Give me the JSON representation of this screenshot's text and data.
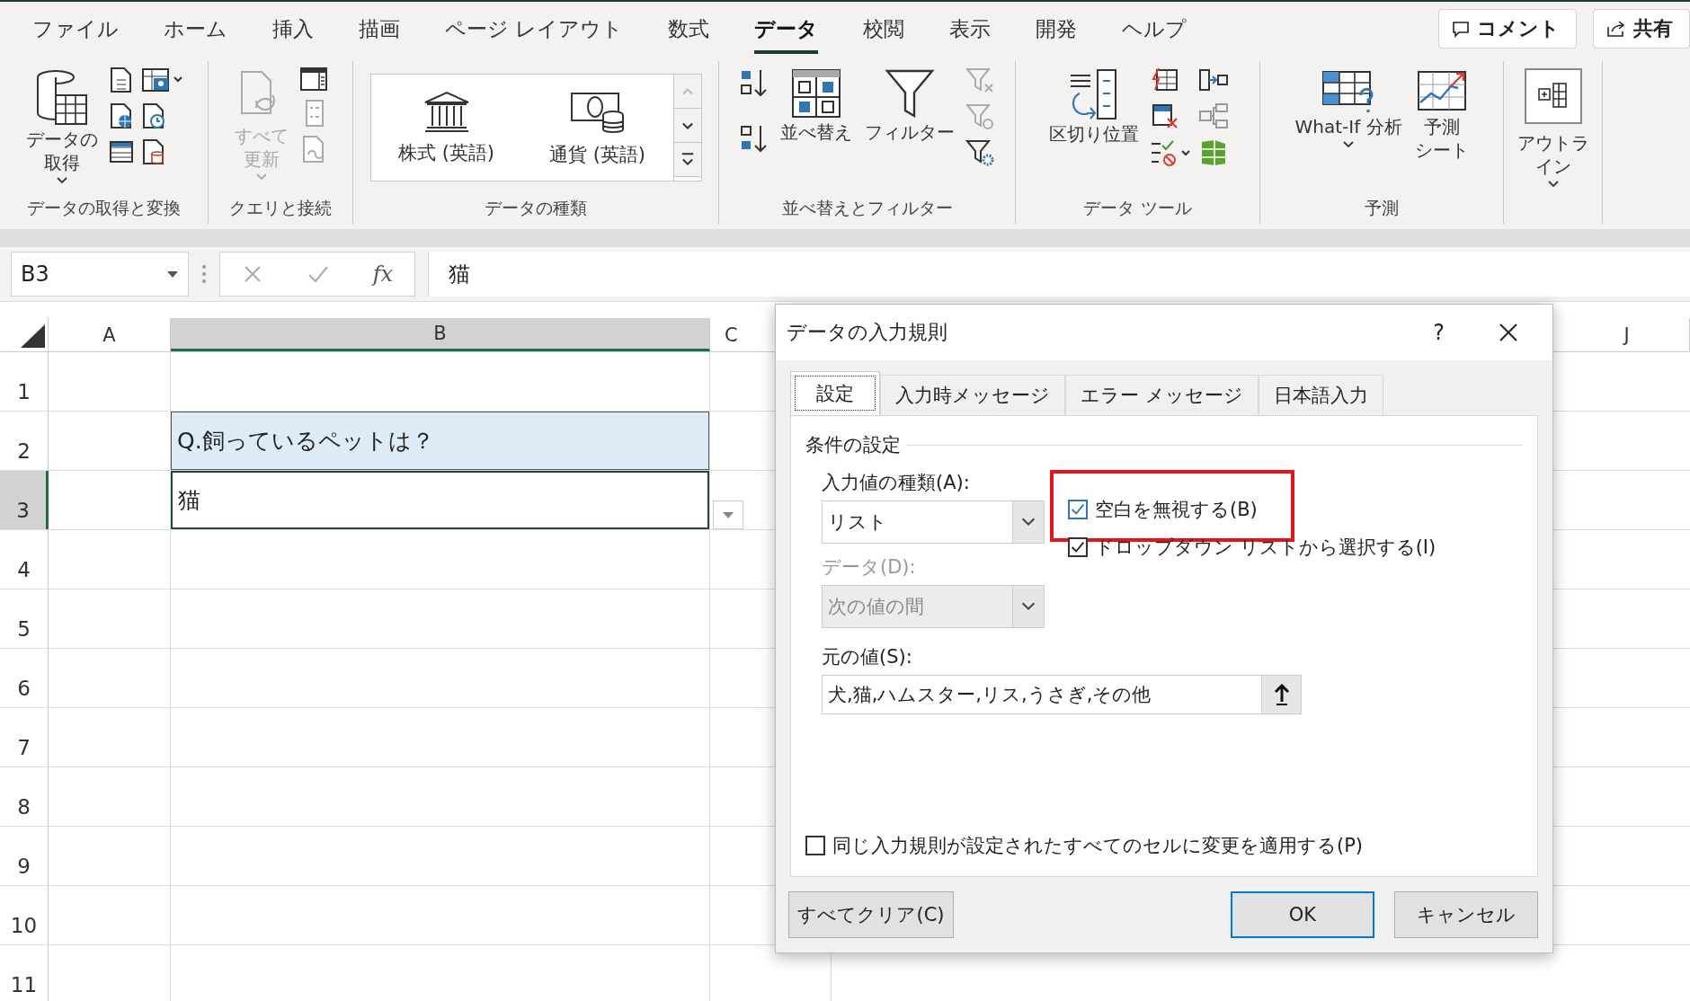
{
  "ribbon_tabs": [
    {
      "label": "ファイル",
      "selected": false
    },
    {
      "label": "ホーム",
      "selected": false
    },
    {
      "label": "挿入",
      "selected": false
    },
    {
      "label": "描画",
      "selected": false
    },
    {
      "label": "ページ レイアウト",
      "selected": false
    },
    {
      "label": "数式",
      "selected": false
    },
    {
      "label": "データ",
      "selected": true
    },
    {
      "label": "校閲",
      "selected": false
    },
    {
      "label": "表示",
      "selected": false
    },
    {
      "label": "開発",
      "selected": false
    },
    {
      "label": "ヘルプ",
      "selected": false
    }
  ],
  "header_buttons": [
    {
      "label": "コメント",
      "kind": "comment"
    },
    {
      "label": "共有",
      "kind": "share"
    }
  ],
  "ribbon_groups": [
    {
      "label": "データの取得と変換",
      "large": {
        "lines": [
          "データの",
          "取得"
        ],
        "dropdown": true,
        "disabled": false
      }
    },
    {
      "label": "クエリと接続",
      "large": {
        "lines": [
          "すべて",
          "更新"
        ],
        "dropdown": true,
        "disabled": true
      }
    },
    {
      "label": "データの種類",
      "gallery": [
        "株式 (英語)",
        "通貨 (英語)"
      ]
    },
    {
      "label": "並べ替えとフィルター",
      "sort": {
        "lines": [
          "並べ替え"
        ],
        "dropdown": false,
        "disabled": false
      },
      "filter": {
        "lines": [
          "フィルター"
        ],
        "dropdown": false,
        "disabled": false
      }
    },
    {
      "label": "データ ツール",
      "large": {
        "lines": [
          "区切り位置"
        ],
        "dropdown": false,
        "disabled": false
      }
    },
    {
      "label": "予測",
      "whatif": {
        "lines": [
          "What-If 分析"
        ],
        "dropdown": true,
        "disabled": false
      },
      "forecast": {
        "lines": [
          "予測",
          "シート"
        ],
        "dropdown": false,
        "disabled": false
      }
    },
    {
      "outline": {
        "lines": [
          "アウトラ",
          "イン"
        ],
        "dropdown": true,
        "disabled": false
      }
    }
  ],
  "formula_bar": {
    "name_box": "B3",
    "fx": "fx",
    "value": "猫"
  },
  "columns": [
    {
      "label": "A",
      "selected": false
    },
    {
      "label": "B",
      "selected": true
    },
    {
      "label": "C",
      "selected": false
    },
    {
      "label": "J",
      "selected": false
    }
  ],
  "rows": [
    {
      "label": "1",
      "selected": false
    },
    {
      "label": "2",
      "selected": false,
      "cell_b": {
        "text": "Q.飼っているペットは？",
        "highlighted": true,
        "active": false
      }
    },
    {
      "label": "3",
      "selected": true,
      "cell_b": {
        "text": "猫",
        "highlighted": false,
        "active": true
      }
    },
    {
      "label": "4",
      "selected": false
    },
    {
      "label": "5",
      "selected": false
    },
    {
      "label": "6",
      "selected": false
    },
    {
      "label": "7",
      "selected": false
    },
    {
      "label": "8",
      "selected": false
    },
    {
      "label": "9",
      "selected": false
    },
    {
      "label": "10",
      "selected": false
    },
    {
      "label": "11",
      "selected": false
    }
  ],
  "dialog": {
    "title": "データの入力規則",
    "help": "?",
    "tabs": [
      {
        "label": "設定",
        "selected": true
      },
      {
        "label": "入力時メッセージ",
        "selected": false
      },
      {
        "label": "エラー メッセージ",
        "selected": false
      },
      {
        "label": "日本語入力",
        "selected": false
      }
    ],
    "section_title": "条件の設定",
    "allow_label": "入力値の種類(A):",
    "allow_value": "リスト",
    "data_label": "データ(D):",
    "data_value": "次の値の間",
    "data_disabled": true,
    "checkboxes": [
      {
        "label": "空白を無視する(B)",
        "checked": true,
        "highlighted": true
      },
      {
        "label": "ドロップダウン リストから選択する(I)",
        "checked": true,
        "highlighted": false
      }
    ],
    "source_label": "元の値(S):",
    "source_value": "犬,猫,ハムスター,リス,うさぎ,その他",
    "apply_all": {
      "label": "同じ入力規則が設定されたすべてのセルに変更を適用する(P)",
      "checked": false
    },
    "buttons": [
      {
        "label": "すべてクリア(C)",
        "kind": "secondary"
      },
      {
        "label": "OK",
        "kind": "default"
      },
      {
        "label": "キャンセル",
        "kind": "secondary"
      }
    ]
  }
}
